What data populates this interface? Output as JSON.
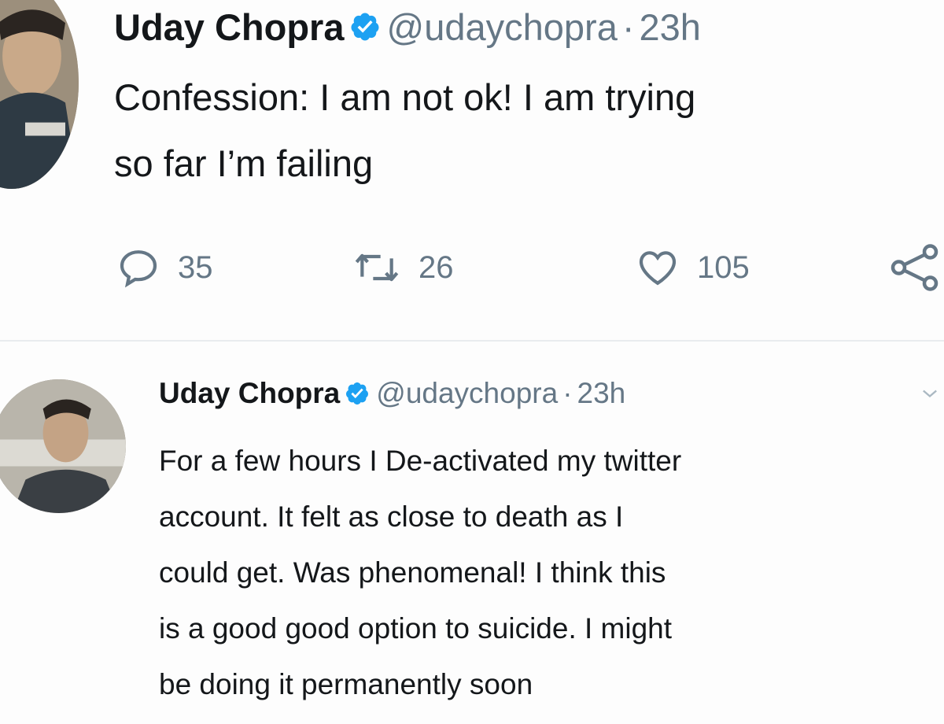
{
  "tweets": [
    {
      "author_name": "Uday Chopra",
      "handle": "@udaychopra",
      "separator": "·",
      "time": "23h",
      "verified_icon": "verified-badge-icon",
      "text_lines": [
        "Confession: I am not ok! I am trying",
        "so far I’m failing"
      ],
      "actions": {
        "reply_count": "35",
        "retweet_count": "26",
        "like_count": "105"
      }
    },
    {
      "author_name": "Uday Chopra",
      "handle": "@udaychopra",
      "separator": "·",
      "time": "23h",
      "verified_icon": "verified-badge-icon",
      "text_lines": [
        "For a few hours I De-activated my twitter",
        "account. It felt as close to death as I",
        "could get. Was phenomenal! I think this",
        "is a good good option to suicide. I might",
        "be doing it permanently soon"
      ]
    }
  ],
  "colors": {
    "verified": "#1da1f2",
    "muted_text": "#657786",
    "primary_text": "#14171a",
    "divider": "#e9ecef"
  }
}
